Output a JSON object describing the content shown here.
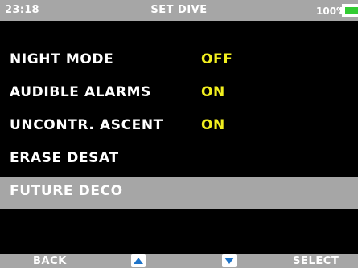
{
  "status": {
    "time": "23:18",
    "title": "SET DIVE",
    "battery_level": "100%"
  },
  "menu": {
    "items": [
      {
        "label": "NIGHT MODE",
        "value": "OFF"
      },
      {
        "label": "AUDIBLE ALARMS",
        "value": "ON"
      },
      {
        "label": "UNCONTR. ASCENT",
        "value": "ON"
      },
      {
        "label": "ERASE DESAT",
        "value": ""
      },
      {
        "label": "FUTURE DECO",
        "value": ""
      }
    ],
    "selected_index": 4
  },
  "softkeys": {
    "back": "BACK",
    "up_icon": "arrow-up-icon",
    "down_icon": "arrow-down-icon",
    "select": "SELECT"
  },
  "colors": {
    "bar_gray": "#a6a6a6",
    "background": "#000000",
    "value_yellow": "#f2ef1f",
    "battery_green": "#33cc33",
    "arrow_blue": "#1f74c9"
  }
}
